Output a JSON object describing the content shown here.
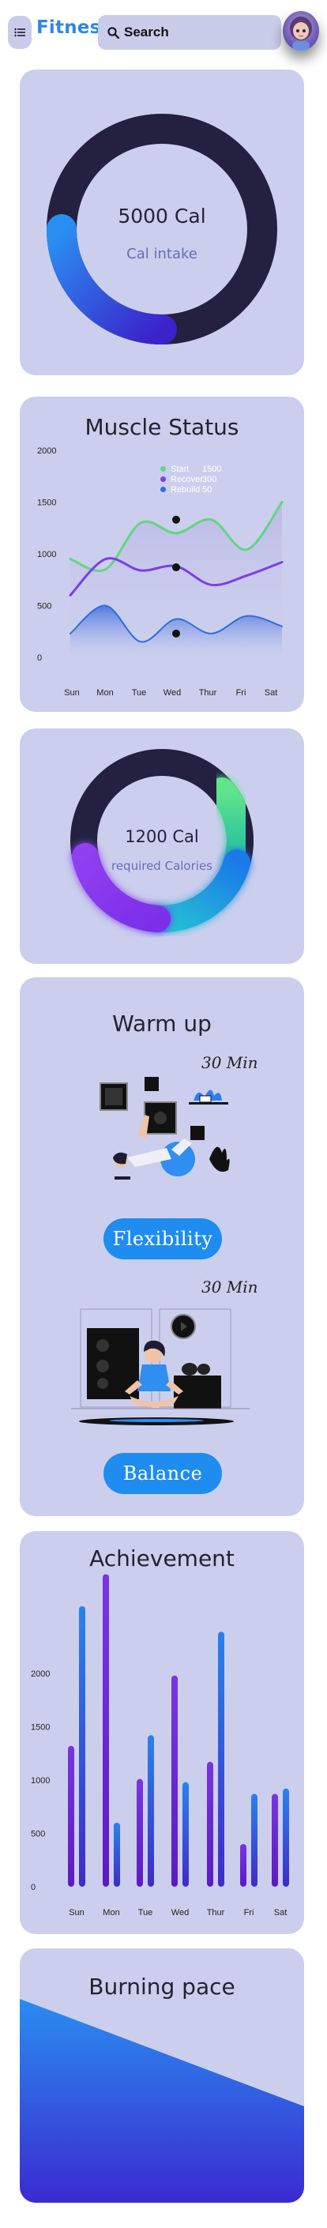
{
  "header": {
    "brand": "Fitness",
    "search_placeholder": "Search",
    "menu_icon": "list-icon",
    "search_icon": "search-icon",
    "avatar_icon": "user-avatar"
  },
  "calorie_intake": {
    "value_label": "5000 Cal",
    "caption": "Cal intake",
    "progress_fraction": 0.25,
    "colors": {
      "track": "#23213f",
      "accent": "#2273e6"
    }
  },
  "muscle_status": {
    "title": "Muscle Status",
    "legend": [
      {
        "label": "Start",
        "value": "1500",
        "color": "#5fd87f"
      },
      {
        "label": "Recover",
        "value": "300",
        "color": "#7c3ee6"
      },
      {
        "label": "Rebuild",
        "value": "50",
        "color": "#2b6fe0"
      }
    ]
  },
  "chart_data": [
    {
      "type": "line",
      "title": "Muscle Status",
      "x": [
        "Sun",
        "Mon",
        "Tue",
        "Wed",
        "Thur",
        "Fri",
        "Sat"
      ],
      "ylim": [
        0,
        2000
      ],
      "yticks": [
        0,
        500,
        1000,
        1500,
        2000
      ],
      "grid": false,
      "legend_position": "top-center",
      "series": [
        {
          "name": "Start",
          "color": "#5fd87f",
          "values": [
            950,
            850,
            1300,
            1200,
            1330,
            1040,
            1500
          ]
        },
        {
          "name": "Recover",
          "color": "#7c3ee6",
          "values": [
            600,
            950,
            840,
            880,
            700,
            790,
            920
          ]
        },
        {
          "name": "Rebuild",
          "color": "#2b6fe0",
          "values": [
            230,
            500,
            150,
            370,
            230,
            400,
            300
          ]
        }
      ],
      "markers": [
        {
          "series": "Start",
          "x": "Wed",
          "value": 1330
        },
        {
          "series": "Recover",
          "x": "Wed",
          "value": 870
        },
        {
          "series": "Rebuild",
          "x": "Wed",
          "value": 230
        }
      ]
    },
    {
      "type": "bar",
      "title": "Achievement",
      "categories": [
        "Sun",
        "Mon",
        "Tue",
        "Wed",
        "Thur",
        "Fri",
        "Sat"
      ],
      "ylim": [
        0,
        2000
      ],
      "yticks": [
        0,
        500,
        1000,
        1500,
        2000
      ],
      "grid": false,
      "series": [
        {
          "color": "#7a35e0",
          "values": [
            1320,
            2930,
            1010,
            1980,
            1170,
            400,
            870
          ]
        },
        {
          "color": "#2378e6",
          "values": [
            2630,
            600,
            1420,
            980,
            2390,
            870,
            920
          ]
        }
      ]
    }
  ],
  "required_calories": {
    "value_label": "1200 Cal",
    "caption": "required Calories",
    "segments": [
      {
        "name": "dark",
        "fraction": 0.4,
        "color": "#23213f"
      },
      {
        "name": "green",
        "fraction": 0.17,
        "color": "#3ee08c"
      },
      {
        "name": "blue",
        "fraction": 0.23,
        "color": "#1a78e5"
      },
      {
        "name": "purple",
        "fraction": 0.2,
        "color": "#7a2ee6"
      }
    ]
  },
  "warm_up": {
    "title": "Warm up",
    "items": [
      {
        "duration": "30 Min",
        "button_label": "Flexibility"
      },
      {
        "duration": "30 Min",
        "button_label": "Balance"
      }
    ]
  },
  "achievement": {
    "title": "Achievement"
  },
  "burning_pace": {
    "title": "Burning pace",
    "colors": {
      "top": "#2a8cf0",
      "bottom": "#3a2bd0"
    }
  }
}
